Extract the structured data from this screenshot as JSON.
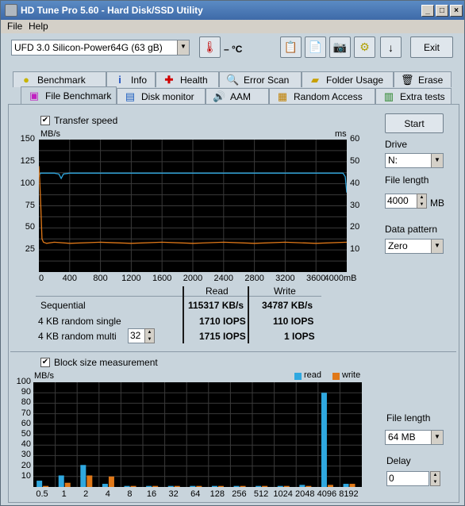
{
  "window": {
    "title": "HD Tune Pro 5.60 - Hard Disk/SSD Utility"
  },
  "menu": [
    "File",
    "Help"
  ],
  "toolbar": {
    "drive": "UFD 3.0 Silicon-Power64G (63 gB)",
    "temperature": "– °C",
    "exit_label": "Exit"
  },
  "tabs_top": [
    "Benchmark",
    "Info",
    "Health",
    "Error Scan",
    "Folder Usage",
    "Erase"
  ],
  "tabs_bottom": [
    "File Benchmark",
    "Disk monitor",
    "AAM",
    "Random Access",
    "Extra tests"
  ],
  "transfer": {
    "checkbox_label": "Transfer speed",
    "unit_left": "MB/s",
    "unit_right": "ms",
    "y_left": [
      "150",
      "125",
      "100",
      "75",
      "50",
      "25"
    ],
    "y_right": [
      "60",
      "50",
      "40",
      "30",
      "20",
      "10"
    ],
    "x_ticks": [
      "0",
      "400",
      "800",
      "1200",
      "1600",
      "2000",
      "2400",
      "2800",
      "3200",
      "3600",
      "4000mB"
    ]
  },
  "results": {
    "headers": [
      "Read",
      "Write"
    ],
    "rows": [
      {
        "label": "Sequential",
        "read": "115317 KB/s",
        "write": "34787 KB/s"
      },
      {
        "label": "4 KB random single",
        "read": "1710 IOPS",
        "write": "110 IOPS"
      },
      {
        "label": "4 KB random multi",
        "read": "1715 IOPS",
        "write": "1 IOPS"
      }
    ],
    "multi_value": "32"
  },
  "right_panel": {
    "start_label": "Start",
    "drive_label": "Drive",
    "drive_value": "N:",
    "file_length_label": "File length",
    "file_length_value": "4000",
    "file_length_unit": "MB",
    "data_pattern_label": "Data pattern",
    "data_pattern_value": "Zero"
  },
  "block": {
    "checkbox_label": "Block size measurement",
    "unit": "MB/s",
    "legend_read": "read",
    "legend_write": "write",
    "file_length_label": "File length",
    "file_length_value": "64 MB",
    "delay_label": "Delay",
    "delay_value": "0"
  },
  "colors": {
    "read": "#2fa8e0",
    "write": "#e07818",
    "chart_bg": "#000000",
    "grid": "#3a3a3a"
  },
  "chart_data": [
    {
      "type": "line",
      "x_range": [
        0,
        4000
      ],
      "ylim_left": [
        0,
        150
      ],
      "ylim_right": [
        0,
        60
      ],
      "series": [
        {
          "axis": "left",
          "x": [
            0,
            20,
            40,
            60,
            200,
            260,
            290,
            320,
            400,
            800,
            1200,
            1600,
            2000,
            2400,
            2800,
            3200,
            3600,
            3950,
            3980,
            4000
          ],
          "values": [
            108,
            112,
            112,
            112,
            112,
            111,
            106,
            111,
            112,
            112,
            112,
            112,
            112,
            112,
            112,
            112,
            112,
            112,
            108,
            90
          ]
        },
        {
          "axis": "right",
          "x": [
            0,
            10,
            25,
            40,
            60,
            100,
            200,
            400,
            800,
            1200,
            1600,
            2000,
            2400,
            2800,
            3200,
            3600,
            4000
          ],
          "values": [
            48,
            42,
            30,
            15,
            13.5,
            13,
            13.5,
            13,
            13.5,
            13,
            13.5,
            13,
            13.5,
            13,
            13.5,
            13,
            13.5
          ]
        }
      ]
    },
    {
      "type": "bar",
      "categories": [
        "0.5",
        "1",
        "2",
        "4",
        "8",
        "16",
        "32",
        "64",
        "128",
        "256",
        "512",
        "1024",
        "2048",
        "4096",
        "8192"
      ],
      "ylim": [
        0,
        100
      ],
      "series": [
        {
          "name": "read",
          "values": [
            6,
            11,
            21,
            3,
            1,
            1,
            1,
            1,
            1,
            1,
            1,
            1,
            2,
            90,
            3
          ]
        },
        {
          "name": "write",
          "values": [
            1,
            4,
            11,
            10,
            1,
            1,
            1,
            1,
            1,
            1,
            1,
            1,
            1,
            2,
            3
          ]
        }
      ]
    }
  ]
}
